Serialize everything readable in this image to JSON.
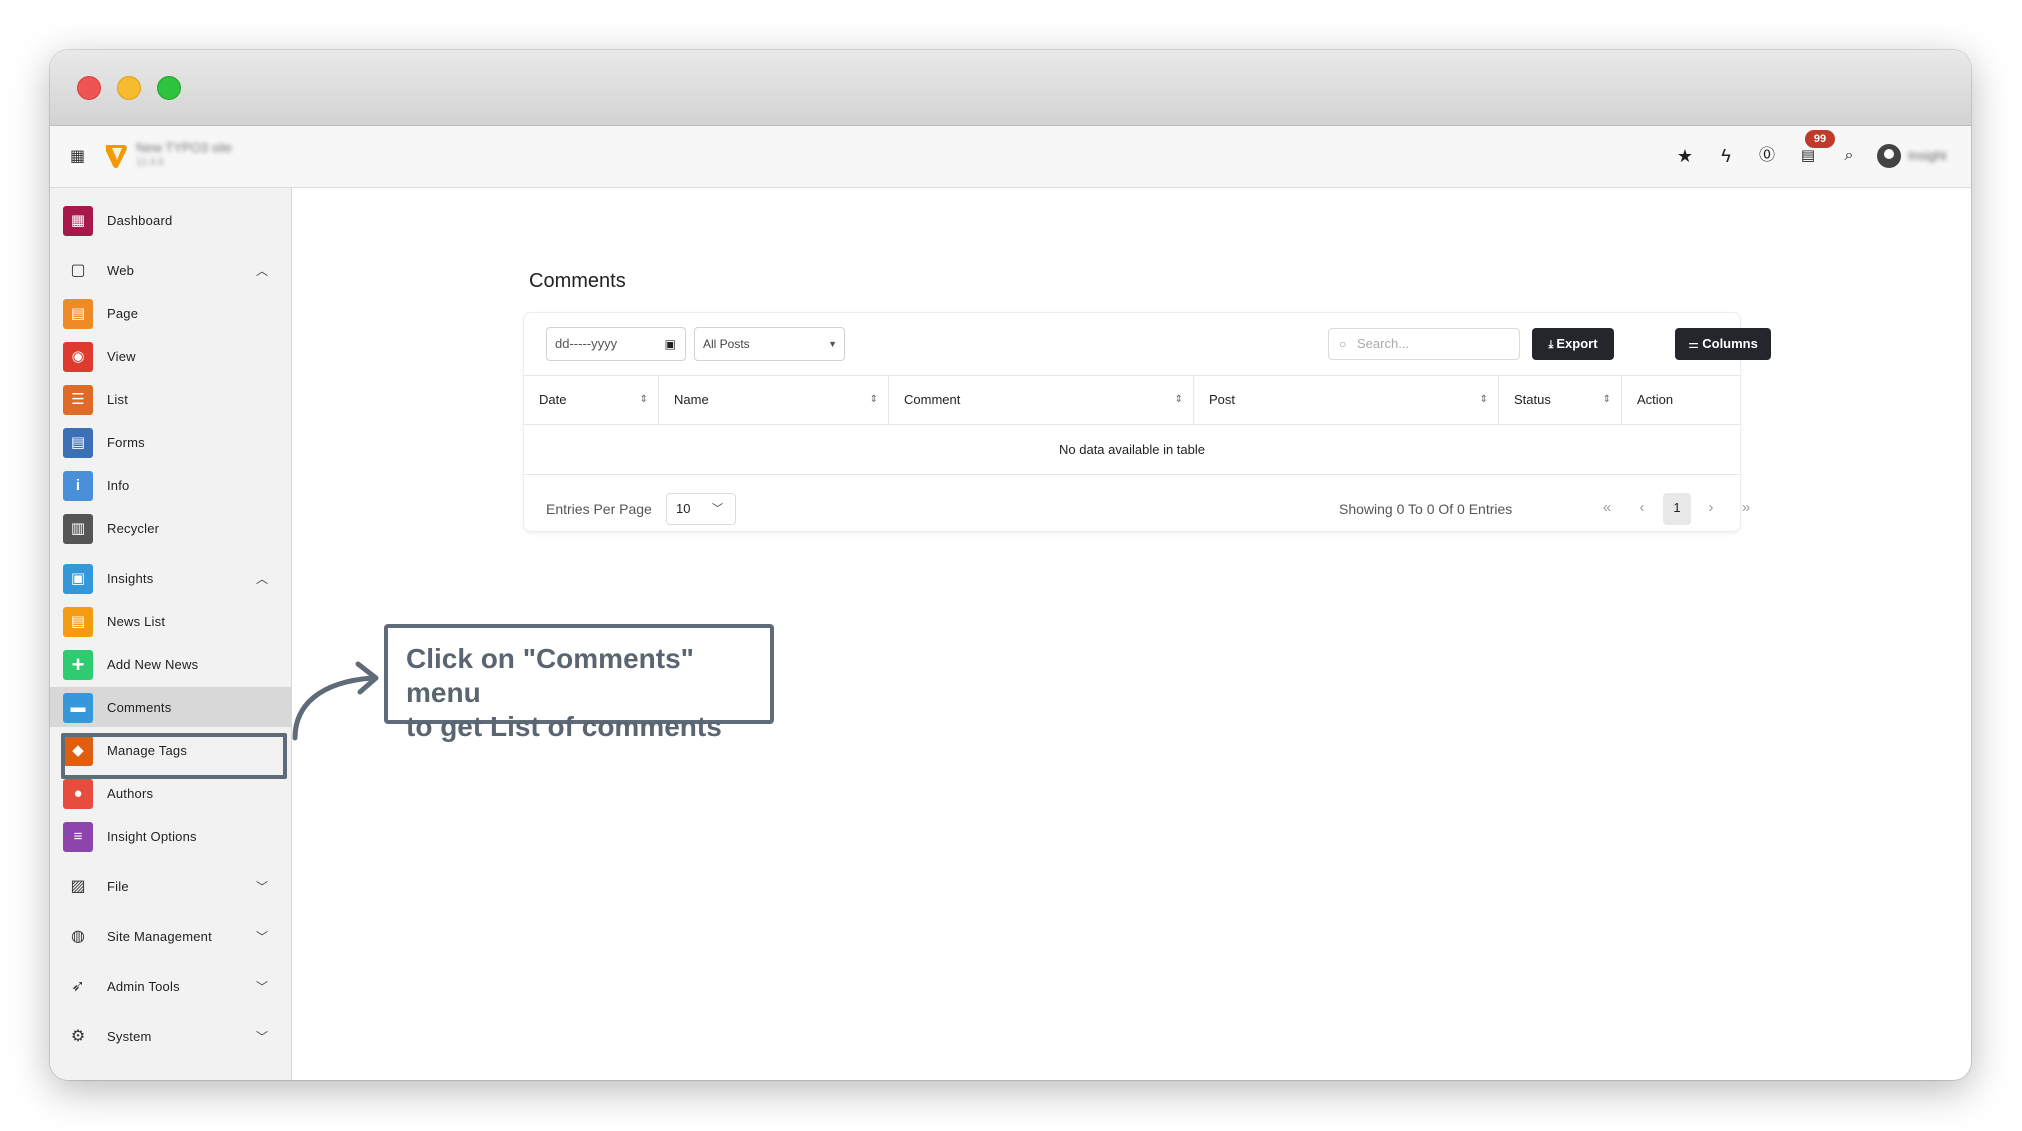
{
  "topbar": {
    "site_name": "New TYPO3 site",
    "site_version": "12.4.8",
    "notification_count": "99",
    "user_name": "Insight"
  },
  "sidebar": {
    "items": [
      {
        "label": "Dashboard",
        "icon": "dashboard-icon",
        "color": "#a8194b",
        "glyph": "▦"
      },
      {
        "label": "Web",
        "icon": "page-icon",
        "glyph": "▢",
        "chevron": "up"
      },
      {
        "label": "Page",
        "icon": "page-icon",
        "color": "#f08a24",
        "glyph": "▤"
      },
      {
        "label": "View",
        "icon": "eye-icon",
        "color": "#de3b2e",
        "glyph": "◉"
      },
      {
        "label": "List",
        "icon": "list-icon",
        "color": "#e06a27",
        "glyph": "☰"
      },
      {
        "label": "Forms",
        "icon": "form-icon",
        "color": "#3b6fb6",
        "glyph": "▤"
      },
      {
        "label": "Info",
        "icon": "info-icon",
        "color": "#4a90d9",
        "glyph": "i"
      },
      {
        "label": "Recycler",
        "icon": "trash-icon",
        "color": "#555555",
        "glyph": "▥"
      },
      {
        "label": "Insights",
        "icon": "insights-icon",
        "color": "#3498db",
        "glyph": "▣",
        "chevron": "up"
      },
      {
        "label": "News List",
        "icon": "news-icon",
        "color": "#f39c12",
        "glyph": "▤"
      },
      {
        "label": "Add New News",
        "icon": "plus-icon",
        "color": "#2ecc71",
        "glyph": "+"
      },
      {
        "label": "Comments",
        "icon": "comment-icon",
        "color": "#3498db",
        "glyph": "▬"
      },
      {
        "label": "Manage Tags",
        "icon": "tag-icon",
        "color": "#e05e0f",
        "glyph": "◆"
      },
      {
        "label": "Authors",
        "icon": "user-icon",
        "color": "#e74c3c",
        "glyph": "●"
      },
      {
        "label": "Insight Options",
        "icon": "sliders-icon",
        "color": "#8e44ad",
        "glyph": "≡"
      },
      {
        "label": "File",
        "icon": "image-icon",
        "glyph": "▨",
        "chevron": "down"
      },
      {
        "label": "Site Management",
        "icon": "globe-icon",
        "glyph": "◍",
        "chevron": "down"
      },
      {
        "label": "Admin Tools",
        "icon": "rocket-icon",
        "glyph": "➶",
        "chevron": "down"
      },
      {
        "label": "System",
        "icon": "gear-icon",
        "glyph": "⚙",
        "chevron": "down"
      }
    ]
  },
  "main": {
    "title": "Comments",
    "date_placeholder": "dd-----yyyy",
    "posts_filter": "All Posts",
    "search_placeholder": "Search...",
    "export_label": "Export",
    "columns_label": "Columns",
    "table": {
      "headers": [
        "Date",
        "Name",
        "Comment",
        "Post",
        "Status",
        "Action"
      ],
      "empty_text": "No data available in table"
    },
    "entries_label": "Entries Per Page",
    "entries_value": "10",
    "showing_text": "Showing 0 To 0 Of 0 Entries",
    "pagination": {
      "first": "«",
      "prev": "‹",
      "current": "1",
      "next": "›",
      "last": "»"
    }
  },
  "callout": {
    "line1": "Click on \"Comments\" menu",
    "line2": "to get List of comments"
  },
  "colors": {
    "callout_border": "#5f6b78",
    "button_dark": "#23272b",
    "badge": "#c0392b"
  }
}
